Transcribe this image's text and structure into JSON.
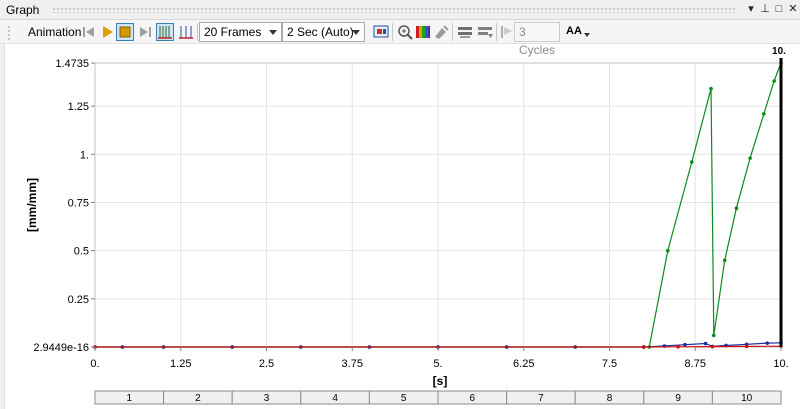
{
  "panel": {
    "title": "Graph"
  },
  "window_controls": {
    "menu": "▾",
    "pin": "⊥",
    "maximize": "□",
    "close": "✕"
  },
  "toolbar": {
    "animation_label": "Animation",
    "frames": "20 Frames",
    "duration": "2 Sec (Auto)",
    "cycles": "3 Cycles",
    "aa_label": "AA"
  },
  "colors": {
    "green": "#0a8a1f",
    "blue": "#1a2f9e",
    "red": "#d01010",
    "grid": "#e4e4e4"
  },
  "chart_data": {
    "type": "line",
    "xlabel": "[s]",
    "ylabel": "[mm/mm]",
    "xlim": [
      0,
      10
    ],
    "ylim": [
      2.9449e-16,
      1.4735
    ],
    "x_ticks": [
      "0.",
      "1.25",
      "2.5",
      "3.75",
      "5.",
      "6.25",
      "7.5",
      "8.75",
      "10."
    ],
    "y_ticks": [
      "2.9449e-16",
      "0.25",
      "0.5",
      "0.75",
      "1.",
      "1.25",
      "1.4735"
    ],
    "grid": true,
    "marker_label": "10.",
    "steps": [
      "1",
      "2",
      "3",
      "4",
      "5",
      "6",
      "7",
      "8",
      "9",
      "10"
    ],
    "step_bounds": [
      0,
      1,
      2,
      3,
      4,
      5,
      6,
      7,
      8,
      9,
      10
    ],
    "series": [
      {
        "color": "green",
        "x": [
          0.0,
          0.4,
          1.0,
          2.0,
          3.0,
          4.0,
          5.0,
          6.0,
          7.0,
          8.0,
          8.08,
          8.35,
          8.7,
          8.98,
          9.02,
          9.18,
          9.35,
          9.55,
          9.75,
          9.9,
          10.0
        ],
        "y": [
          0,
          0,
          0,
          0,
          0,
          0,
          0,
          0,
          0,
          0,
          0,
          0.5,
          0.96,
          1.34,
          0.06,
          0.45,
          0.72,
          0.98,
          1.21,
          1.38,
          1.4735
        ]
      },
      {
        "color": "blue",
        "x": [
          0.0,
          0.4,
          1.0,
          2.0,
          3.0,
          4.0,
          5.0,
          6.0,
          7.0,
          8.0,
          8.3,
          8.6,
          8.9,
          9.0,
          9.2,
          9.5,
          9.8,
          10.0
        ],
        "y": [
          0,
          0,
          0,
          0,
          0,
          0,
          0,
          0,
          0,
          0,
          0.005,
          0.012,
          0.018,
          0.003,
          0.008,
          0.014,
          0.02,
          0.022
        ]
      },
      {
        "color": "red",
        "x": [
          0.0,
          8.0,
          8.5,
          9.0,
          9.5,
          10.0
        ],
        "y": [
          0,
          0,
          0.001,
          0.002,
          0.003,
          0.004
        ]
      }
    ]
  }
}
